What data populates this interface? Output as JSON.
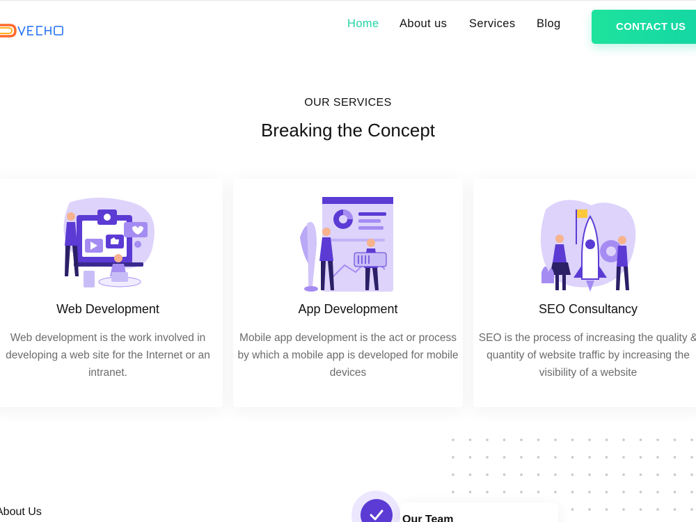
{
  "header": {
    "logo_text": "DIVECHO",
    "nav": [
      {
        "label": "Home",
        "active": true
      },
      {
        "label": "About us",
        "active": false
      },
      {
        "label": "Services",
        "active": false
      },
      {
        "label": "Blog",
        "active": false
      }
    ],
    "contact_label": "CONTACT US"
  },
  "services": {
    "eyebrow": "OUR SERVICES",
    "headline": "Breaking the Concept",
    "cards": [
      {
        "title": "Web Development",
        "text": "Web development is the work involved in developing a web site for the Internet or an intranet.",
        "illustration": "web-development-illustration"
      },
      {
        "title": "App Development",
        "text": "Mobile app development is the act or process by which a mobile app is developed for mobile devices",
        "illustration": "app-development-illustration"
      },
      {
        "title": "SEO Consultancy",
        "text": "SEO is the process of increasing the quality & quantity of website traffic by increasing the visibility of a website",
        "illustration": "seo-illustration"
      }
    ]
  },
  "bottom": {
    "about_label": "About Us",
    "team_label": "Our Team",
    "team_icon": "check-icon"
  },
  "colors": {
    "accent": "#22d3a6",
    "button": "#1ee39d",
    "illustration_purple": "#5b3bd4",
    "illustration_light": "#ddd3fb",
    "body_text": "#6b6b6b"
  }
}
